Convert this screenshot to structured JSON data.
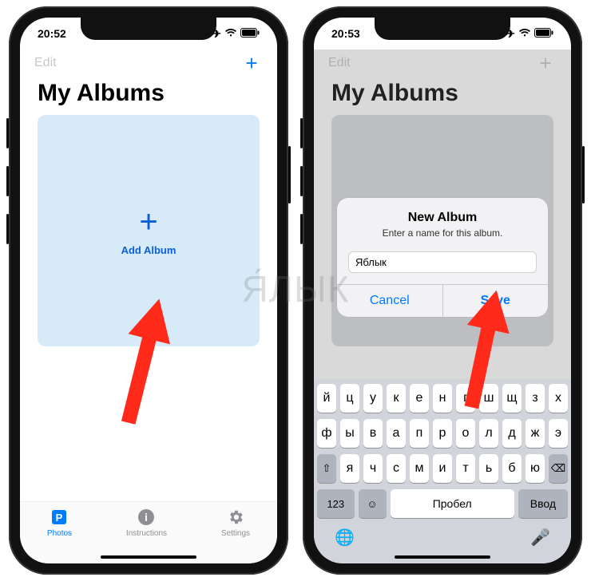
{
  "watermark": "Я́ЛЫК",
  "left": {
    "status_time": "20:52",
    "nav": {
      "edit": "Edit",
      "plus": "+"
    },
    "title": "My Albums",
    "tile": {
      "plus": "+",
      "label": "Add Album"
    },
    "tabs": {
      "photos": "Photos",
      "instructions": "Instructions",
      "settings": "Settings"
    }
  },
  "right": {
    "status_time": "20:53",
    "nav": {
      "edit": "Edit",
      "plus": "+"
    },
    "title": "My Albums",
    "tile": {
      "plus": "+"
    },
    "alert": {
      "title": "New Album",
      "subtitle": "Enter a name for this album.",
      "input_value": "Яблык",
      "cancel": "Cancel",
      "save": "Save"
    },
    "keyboard": {
      "row1": [
        "й",
        "ц",
        "у",
        "к",
        "е",
        "н",
        "г",
        "ш",
        "щ",
        "з",
        "х"
      ],
      "row2": [
        "ф",
        "ы",
        "в",
        "а",
        "п",
        "р",
        "о",
        "л",
        "д",
        "ж",
        "э"
      ],
      "row3": [
        "я",
        "ч",
        "с",
        "м",
        "и",
        "т",
        "ь",
        "б",
        "ю"
      ],
      "shift": "⇧",
      "backspace": "⌫",
      "numkey": "123",
      "emoji": "☺",
      "space": "Пробел",
      "enter": "Ввод",
      "globe": "🌐",
      "mic": "🎤"
    }
  }
}
